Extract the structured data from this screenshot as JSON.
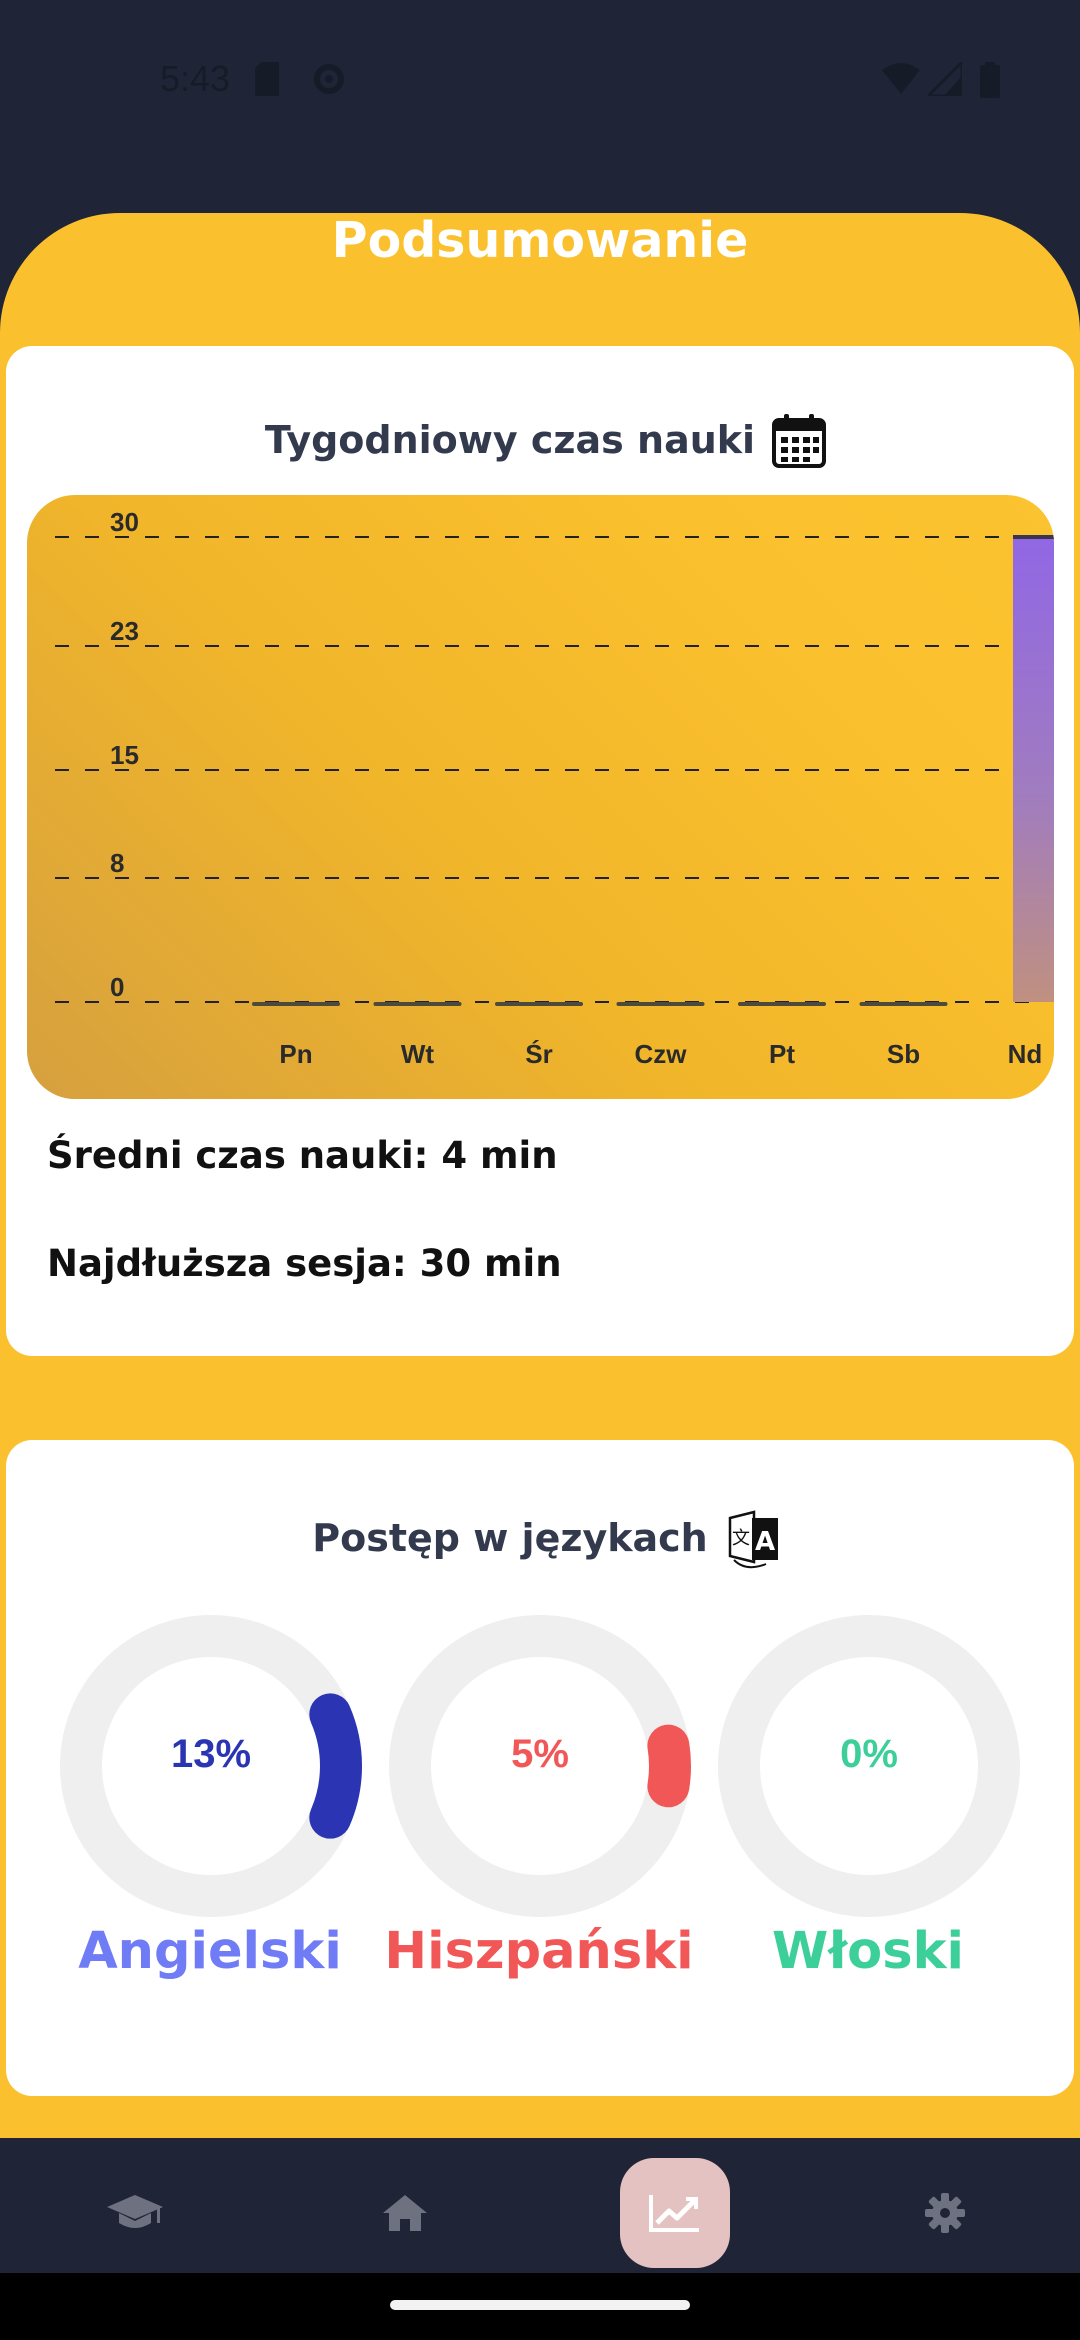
{
  "status_bar": {
    "time": "5:43"
  },
  "header": {
    "title": "Podsumowanie"
  },
  "weekly": {
    "heading": "Tygodniowy czas nauki",
    "avg_label": "Średni czas nauki: 4 min",
    "longest_label": "Najdłuższa sesja: 30 min"
  },
  "chart_data": {
    "type": "bar",
    "categories": [
      "Pn",
      "Wt",
      "Śr",
      "Czw",
      "Pt",
      "Sb",
      "Nd"
    ],
    "values": [
      0,
      0,
      0,
      0,
      0,
      0,
      30
    ],
    "yticks": [
      "30",
      "23",
      "15",
      "8",
      "0"
    ],
    "ylim": [
      0,
      30
    ],
    "grid": true,
    "colors": {
      "bar": "#9167e4",
      "bar_bottom": "#c09080",
      "zero_bar": "#4b4a3c",
      "grid": "#222222"
    }
  },
  "languages": {
    "heading": "Postęp w językach",
    "items": [
      {
        "name": "Angielski",
        "percent_label": "13%",
        "progress": 0.13,
        "color": "#2b35b4",
        "name_color": "#6f7cf5"
      },
      {
        "name": "Hiszpański",
        "percent_label": "5%",
        "progress": 0.05,
        "color": "#f25757",
        "name_color": "#f25757"
      },
      {
        "name": "Włoski",
        "percent_label": "0%",
        "progress": 0.0,
        "color": "#3ccf99",
        "name_color": "#3ccf99"
      }
    ]
  },
  "nav": {
    "items": [
      {
        "icon": "graduation-cap-icon",
        "active": false
      },
      {
        "icon": "home-icon",
        "active": false
      },
      {
        "icon": "chart-icon",
        "active": true
      },
      {
        "icon": "gear-icon",
        "active": false
      }
    ]
  }
}
